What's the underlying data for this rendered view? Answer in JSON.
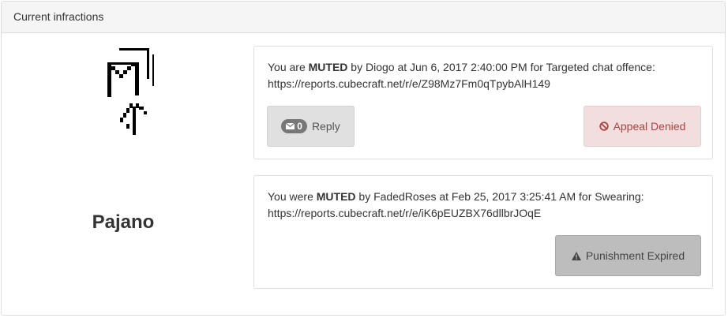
{
  "panel": {
    "title": "Current infractions"
  },
  "player": {
    "name": "Pajano"
  },
  "infractions": [
    {
      "prefix": "You are ",
      "type": "MUTED",
      "by_text": " by Diogo at Jun 6, 2017 2:40:00 PM for Targeted chat offence:",
      "link": "https://reports.cubecraft.net/r/e/Z98Mz7Fm0qTpybAlH149",
      "reply_count": "0",
      "reply_label": "Reply",
      "status": "Appeal Denied",
      "status_icon": "ban-icon"
    },
    {
      "prefix": "You were ",
      "type": "MUTED",
      "by_text": " by FadedRoses at Feb 25, 2017 3:25:41 AM for Swearing:",
      "link": "https://reports.cubecraft.net/r/e/iK6pEUZBX76dllbrJOqE",
      "status": "Punishment Expired",
      "status_icon": "warning-icon"
    }
  ],
  "colors": {
    "denied_bg": "#f2dede",
    "denied_text": "#a94442",
    "expired_bg": "#bdbdbd"
  }
}
